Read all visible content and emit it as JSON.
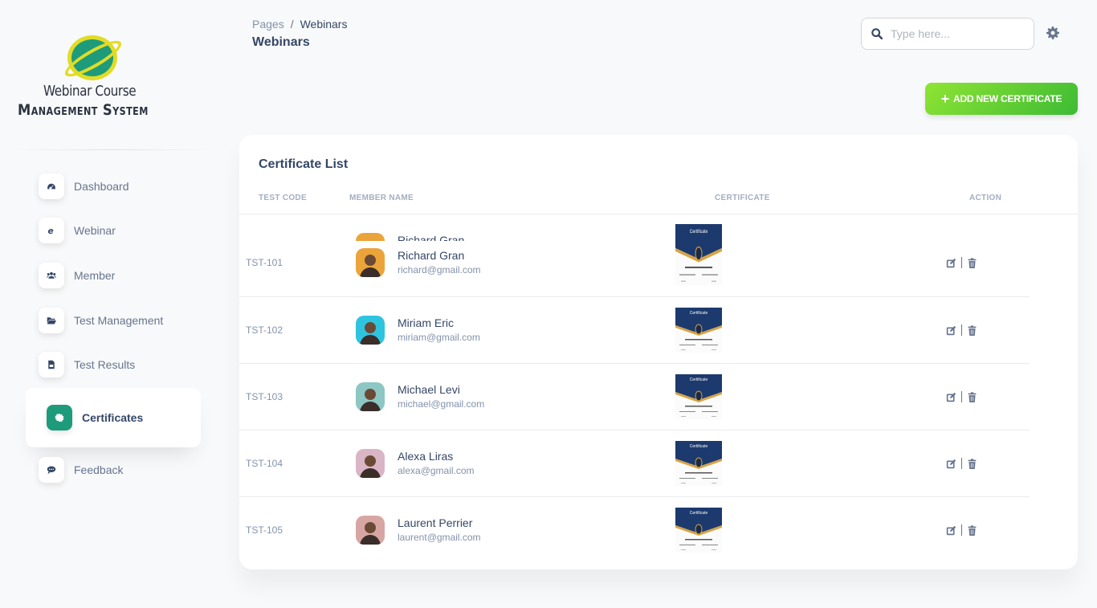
{
  "logo": {
    "line1": "Webinar Course",
    "line2": "Management System",
    "globe_color": "#1e9b7a",
    "ring_color": "#e2dc26"
  },
  "sidebar": {
    "items": [
      {
        "label": "Dashboard",
        "icon": "dashboard-icon",
        "active": false
      },
      {
        "label": "Webinar",
        "icon": "internet-explorer-icon",
        "active": false
      },
      {
        "label": "Member",
        "icon": "users-icon",
        "active": false
      },
      {
        "label": "Test Management",
        "icon": "folder-open-icon",
        "active": false
      },
      {
        "label": "Test Results",
        "icon": "file-icon",
        "active": false
      },
      {
        "label": "Certificates",
        "icon": "certificate-icon",
        "active": true
      },
      {
        "label": "Feedback",
        "icon": "comment-icon",
        "active": false
      }
    ],
    "active_color": "#1e9b7a"
  },
  "header": {
    "breadcrumb": [
      "Pages",
      "Webinars"
    ],
    "breadcrumb_separator": "/",
    "title": "Webinars",
    "search_placeholder": "Type here...",
    "search_value": ""
  },
  "toolbar": {
    "add_label": "ADD NEW CERTIFICATE",
    "add_icon": "plus-icon"
  },
  "card": {
    "title": "Certificate List",
    "columns": [
      "TEST CODE",
      "MEMBER NAME",
      "CERTIFICATE",
      "ACTION"
    ],
    "ghost_row": {
      "name": "Richard Gran"
    },
    "rows": [
      {
        "code": "TST-101",
        "name": "Richard Gran",
        "email": "richard@gmail.com",
        "avatar_bg": "#eba43a",
        "certificate": "Certificate of Participation"
      },
      {
        "code": "TST-102",
        "name": "Miriam Eric",
        "email": "miriam@gmail.com",
        "avatar_bg": "#2ec4e0",
        "certificate": "Certificate of Participation"
      },
      {
        "code": "TST-103",
        "name": "Michael Levi",
        "email": "michael@gmail.com",
        "avatar_bg": "#8cc7c4",
        "certificate": "Certificate of Participation"
      },
      {
        "code": "TST-104",
        "name": "Alexa Liras",
        "email": "alexa@gmail.com",
        "avatar_bg": "#d9b5c6",
        "certificate": "Certificate of Participation"
      },
      {
        "code": "TST-105",
        "name": "Laurent Perrier",
        "email": "laurent@gmail.com",
        "avatar_bg": "#d7a6a3",
        "certificate": "Certificate of Participation"
      }
    ]
  }
}
